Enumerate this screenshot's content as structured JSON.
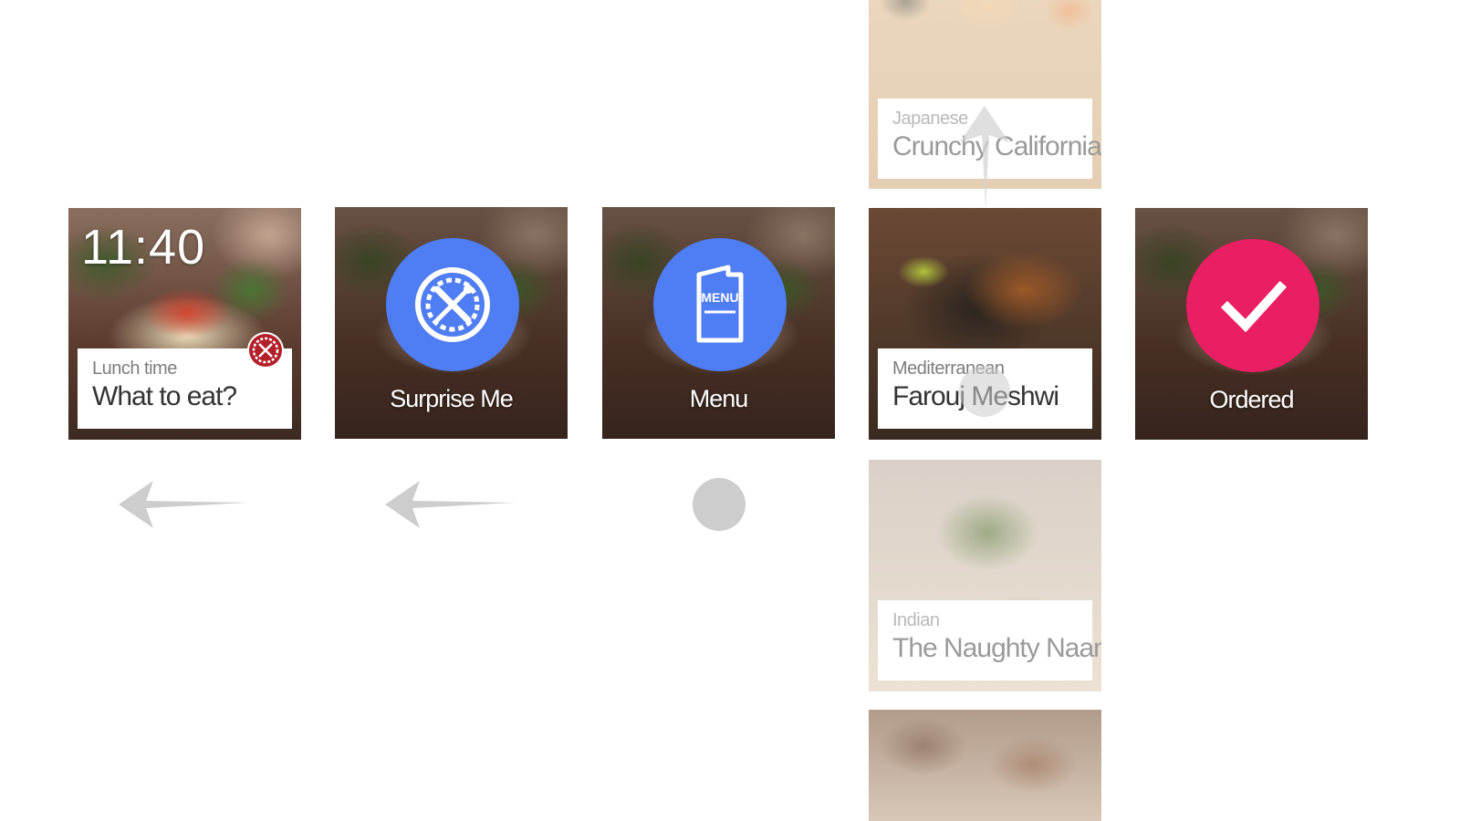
{
  "home_card": {
    "time": "11:40",
    "subtitle": "Lunch time",
    "title": "What to eat?",
    "badge_icon": "restaurant-plate-icon"
  },
  "surprise_card": {
    "icon": "plate-fork-knife-icon",
    "label": "Surprise Me",
    "color": "#4f7df3"
  },
  "menu_card": {
    "icon": "menu-book-icon",
    "icon_text": "MENU",
    "label": "Menu",
    "color": "#4f7df3"
  },
  "restaurants": [
    {
      "cuisine": "Japanese",
      "name": "Crunchy California"
    },
    {
      "cuisine": "Mediterranean",
      "name": "Farouj Meshwi"
    },
    {
      "cuisine": "Indian",
      "name": "The Naughty Naan"
    }
  ],
  "ordered_card": {
    "icon": "checkmark-icon",
    "label": "Ordered",
    "color": "#e91e63"
  },
  "gestures": {
    "swipe_left_1": "swipe-left-arrow",
    "swipe_left_2": "swipe-left-arrow",
    "tap": "tap-dot",
    "swipe_up": "swipe-up-arrow",
    "tap_on_card": "tap-dot"
  }
}
